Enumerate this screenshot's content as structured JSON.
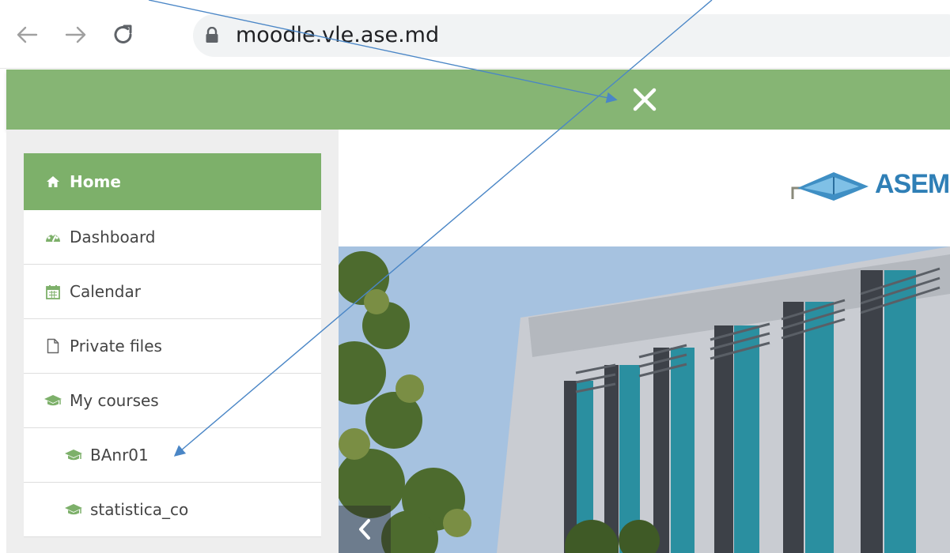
{
  "browser": {
    "url": "moodle.vle.ase.md"
  },
  "header": {
    "close_icon": "close-icon"
  },
  "sidebar": {
    "items": [
      {
        "label": "Home",
        "icon": "home-icon",
        "active": true,
        "level": 1
      },
      {
        "label": "Dashboard",
        "icon": "dashboard-icon",
        "active": false,
        "level": 1
      },
      {
        "label": "Calendar",
        "icon": "calendar-icon",
        "active": false,
        "level": 1
      },
      {
        "label": "Private files",
        "icon": "file-icon",
        "active": false,
        "level": 1
      },
      {
        "label": "My courses",
        "icon": "graduation-cap-icon",
        "active": false,
        "level": 1
      },
      {
        "label": "BAnr01",
        "icon": "graduation-cap-icon",
        "active": false,
        "level": 2
      },
      {
        "label": "statistica_co",
        "icon": "graduation-cap-icon",
        "active": false,
        "level": 2
      }
    ]
  },
  "main": {
    "logo_text": "ASEM"
  },
  "colors": {
    "green_bar": "#86b574",
    "active_item": "#7db06a",
    "annotation_arrow": "#4a86c6"
  }
}
